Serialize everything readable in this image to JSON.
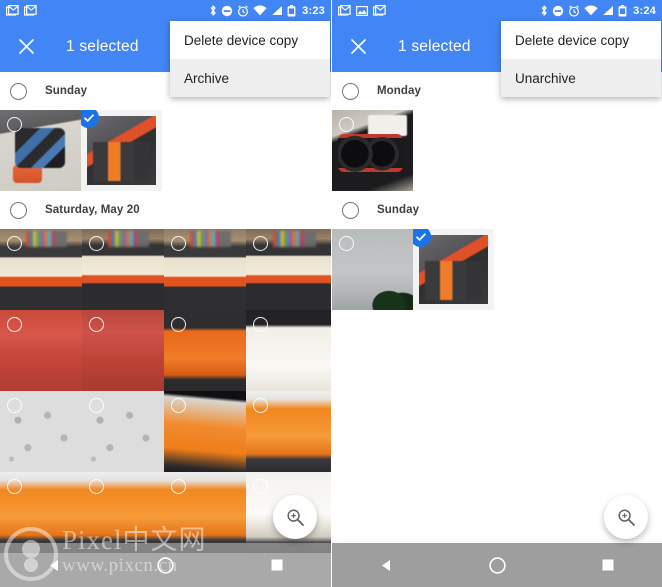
{
  "meta": {
    "app": "Google Photos",
    "accent_color": "#4285f4",
    "selection_badge_color": "#1a73e8",
    "navbar_color": "#9e9e9e"
  },
  "left": {
    "status": {
      "time": "3:23",
      "notification_icons": [
        "gmail-icon",
        "gmail-icon"
      ],
      "system_icons": [
        "bluetooth-icon",
        "do-not-disturb-icon",
        "alarm-icon",
        "wifi-icon",
        "signal-icon",
        "battery-icon"
      ]
    },
    "toolbar": {
      "close_label": "✕",
      "title": "1 selected"
    },
    "menu": {
      "items": [
        {
          "label": "Delete device copy"
        },
        {
          "label": "Archive"
        }
      ]
    },
    "sections": [
      {
        "day_label": "Sunday",
        "rows": [
          [
            {
              "art": "tripod",
              "selected": false
            },
            {
              "art": "keycaps-closeup",
              "selected": true
            }
          ]
        ]
      },
      {
        "day_label": "Saturday, May 20",
        "rows": [
          [
            {
              "art": "kb-a",
              "selected": false
            },
            {
              "art": "kb-b",
              "selected": false
            },
            {
              "art": "kb-a",
              "selected": false
            },
            {
              "art": "kb-b",
              "selected": false
            }
          ],
          [
            {
              "art": "kb-red",
              "selected": false
            },
            {
              "art": "kb-red2",
              "selected": false
            },
            {
              "art": "kb-orange",
              "selected": false
            },
            {
              "art": "kb-white",
              "selected": false
            }
          ],
          [
            {
              "art": "kb-pcb",
              "selected": false
            },
            {
              "art": "kb-pcb",
              "selected": false
            },
            {
              "art": "kb-sw",
              "selected": false
            },
            {
              "art": "kb-keys",
              "selected": false
            }
          ],
          [
            {
              "art": "kb-keys",
              "selected": false
            },
            {
              "art": "kb-keys",
              "selected": false
            },
            {
              "art": "kb-keys",
              "selected": false
            },
            {
              "art": "kb-last",
              "selected": false
            }
          ]
        ]
      }
    ],
    "fab": {
      "icon": "zoom-in-icon"
    },
    "navbar": {
      "back_icon": "back-triangle-icon",
      "home_icon": "home-circle-icon",
      "recents_icon": "recents-square-icon"
    }
  },
  "right": {
    "status": {
      "time": "3:24",
      "notification_icons": [
        "gmail-icon",
        "photo-icon",
        "gmail-icon"
      ],
      "system_icons": [
        "bluetooth-icon",
        "do-not-disturb-icon",
        "alarm-icon",
        "wifi-icon",
        "signal-icon",
        "battery-icon"
      ]
    },
    "toolbar": {
      "close_label": "✕",
      "title": "1 selected"
    },
    "menu": {
      "items": [
        {
          "label": "Delete device copy"
        },
        {
          "label": "Unarchive"
        }
      ]
    },
    "sections": [
      {
        "day_label": "Monday",
        "rows": [
          [
            {
              "art": "gpu",
              "selected": false
            }
          ]
        ]
      },
      {
        "day_label": "Sunday",
        "rows": [
          [
            {
              "art": "sky",
              "selected": false
            },
            {
              "art": "keycaps-closeup",
              "selected": true
            }
          ]
        ]
      }
    ],
    "fab": {
      "icon": "zoom-in-icon"
    },
    "navbar": {
      "back_icon": "back-triangle-icon",
      "home_icon": "home-circle-icon",
      "recents_icon": "recents-square-icon"
    }
  },
  "watermark": {
    "title": "Pixel中文网",
    "url": "www.pixcn.cn"
  }
}
